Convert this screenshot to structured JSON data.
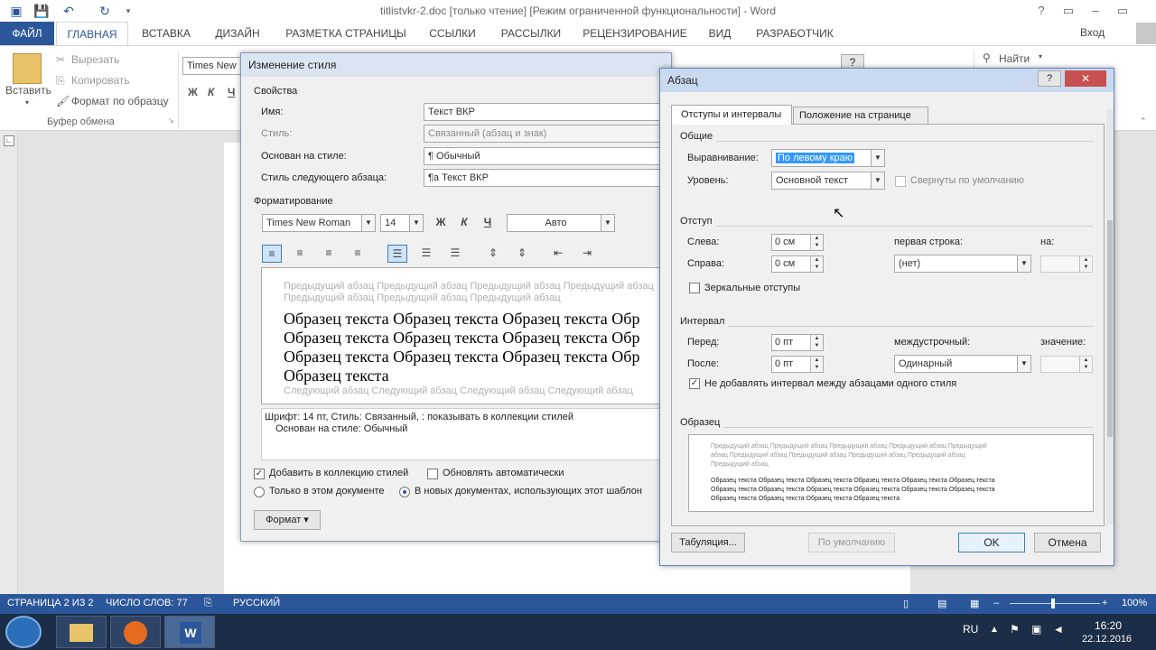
{
  "window": {
    "title": "titlistvkr-2.doc [только чтение] [Режим ограниченной функциональности] - Word",
    "controls": [
      "?",
      "▭",
      "–",
      "▭"
    ]
  },
  "tabs": {
    "file": "ФАЙЛ",
    "home": "ГЛАВНАЯ",
    "insert": "ВСТАВКА",
    "design": "ДИЗАЙН",
    "layout": "РАЗМЕТКА СТРАНИЦЫ",
    "references": "ССЫЛКИ",
    "mailings": "РАССЫЛКИ",
    "review": "РЕЦЕНЗИРОВАНИЕ",
    "view": "ВИД",
    "developer": "РАЗРАБОТЧИК",
    "signin": "Вход"
  },
  "ribbon": {
    "paste": "Вставить",
    "cut": "Вырезать",
    "copy": "Копировать",
    "format_painter": "Формат по образцу",
    "clipboard_group": "Буфер обмена",
    "font_name": "Times New",
    "bold": "Ж",
    "italic": "К",
    "underline": "Ч",
    "find": "Найти"
  },
  "style_dialog": {
    "title": "Изменение стиля",
    "help": "?",
    "close": "✕",
    "properties": "Свойства",
    "name_label": "Имя:",
    "name_value": "Текст ВКР",
    "style_type_label": "Стиль:",
    "style_type_value": "Связанный (абзац и знак)",
    "based_on_label": "Основан на стиле:",
    "based_on_value": "¶  Обычный",
    "next_style_label": "Стиль следующего абзаца:",
    "next_style_value": "¶a  Текст ВКР",
    "formatting": "Форматирование",
    "font": "Times New Roman",
    "size": "14",
    "bold": "Ж",
    "italic": "К",
    "underline": "Ч",
    "color": "Авто",
    "preview_prev": "Предыдущий абзац Предыдущий абзац Предыдущий абзац Предыдущий абзац Предыдущий абзац Предыдущий абзац Предыдущий абзац",
    "preview_lines": [
      "Образец текста Образец текста Образец текста Обр",
      "Образец текста Образец текста Образец текста Обр",
      "Образец текста Образец текста Образец текста Обр",
      "Образец текста"
    ],
    "preview_next": "Следующий абзац Следующий абзац Следующий абзац Следующий абзац",
    "description_line1": "Шрифт: 14 пт, Стиль: Связанный, : показывать в коллекции стилей",
    "description_line2": "Основан на стиле: Обычный",
    "add_to_gallery": "Добавить в коллекцию стилей",
    "auto_update": "Обновлять автоматически",
    "only_this_doc": "Только в этом документе",
    "new_docs": "В новых документах, использующих этот шаблон",
    "format_button": "Формат ▾"
  },
  "para_dialog": {
    "title": "Абзац",
    "help": "?",
    "close": "✕",
    "tab_indents": "Отступы и интервалы",
    "tab_position": "Положение на странице",
    "general": "Общие",
    "alignment_label": "Выравнивание:",
    "alignment_value": "По левому краю",
    "level_label": "Уровень:",
    "level_value": "Основной текст",
    "collapsed_label": "Свернуты по умолчанию",
    "indent": "Отступ",
    "left_label": "Слева:",
    "left_value": "0 см",
    "right_label": "Справа:",
    "right_value": "0 см",
    "first_line_label": "первая строка:",
    "first_line_value": "(нет)",
    "by_label": "на:",
    "mirror_label": "Зеркальные отступы",
    "spacing": "Интервал",
    "before_label": "Перед:",
    "before_value": "0 пт",
    "after_label": "После:",
    "after_value": "0 пт",
    "line_spacing_label": "междустрочный:",
    "line_spacing_value": "Одинарный",
    "value_label": "значение:",
    "no_space_label": "Не добавлять интервал между абзацами одного стиля",
    "preview": "Образец",
    "preview_prev": [
      "Предыдущий абзац Предыдущий абзац Предыдущий абзац Предыдущий абзац Предыдущий",
      "абзац Предыдущий абзац Предыдущий абзац Предыдущий абзац Предыдущий абзац",
      "Предыдущий абзац"
    ],
    "preview_sample": [
      "Образец текста Образец текста Образец текста Образец текста Образец текста Образец текста",
      "Образец текста Образец текста Образец текста Образец текста Образец текста Образец текста",
      "Образец текста Образец текста Образец текста Образец текста"
    ],
    "tabs_button": "Табуляция...",
    "default_button": "По умолчанию",
    "ok": "OK",
    "cancel": "Отмена"
  },
  "status": {
    "page": "СТРАНИЦА 2 ИЗ 2",
    "words": "ЧИСЛО СЛОВ: 77",
    "language": "РУССКИЙ",
    "zoom": "100%"
  },
  "taskbar": {
    "lang": "RU",
    "time": "16:20",
    "date": "22.12.2016"
  },
  "colors": {
    "accent": "#2b579a",
    "dialog_bg": "#f0f0f0",
    "close_red": "#c75050"
  }
}
